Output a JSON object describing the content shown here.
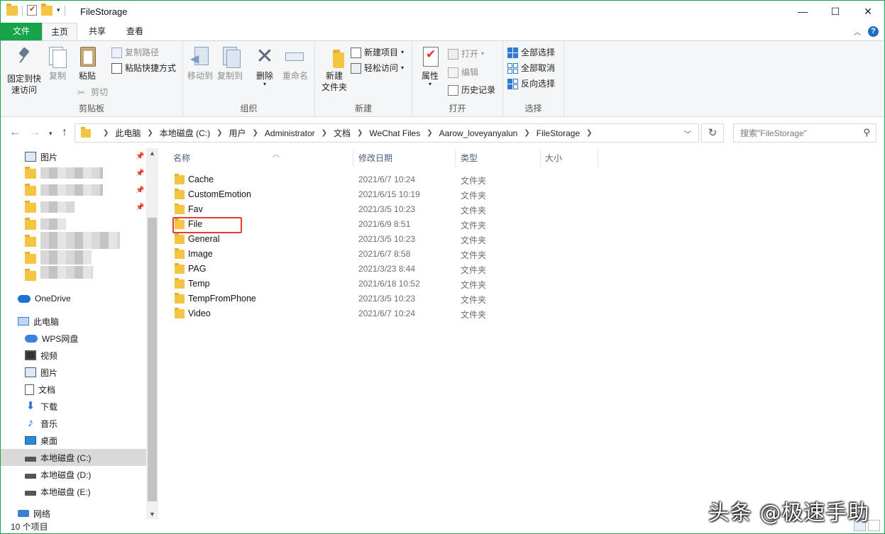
{
  "window": {
    "title": "FileStorage"
  },
  "ribbon_tabs": [
    "文件",
    "主页",
    "共享",
    "查看"
  ],
  "ribbon": {
    "clipboard": {
      "label": "剪贴板",
      "pin": "固定到快速访问",
      "pin_l1": "固定到快",
      "pin_l2": "速访问",
      "copy": "复制",
      "paste": "粘贴",
      "copy_path": "复制路径",
      "paste_shortcut": "粘贴快捷方式",
      "cut": "剪切"
    },
    "organize": {
      "label": "组织",
      "move_to": "移动到",
      "copy_to": "复制到",
      "delete": "删除",
      "rename": "重命名"
    },
    "new": {
      "label": "新建",
      "new_folder_l1": "新建",
      "new_folder_l2": "文件夹",
      "new_item": "新建项目",
      "easy_access": "轻松访问"
    },
    "open": {
      "label": "打开",
      "properties": "属性",
      "open": "打开",
      "edit": "编辑",
      "history": "历史记录"
    },
    "select": {
      "label": "选择",
      "select_all": "全部选择",
      "select_none": "全部取消",
      "invert": "反向选择"
    }
  },
  "address": {
    "crumbs": [
      "此电脑",
      "本地磁盘 (C:)",
      "用户",
      "Administrator",
      "文档",
      "WeChat Files",
      "Aarow_loveyanyalun",
      "FileStorage"
    ],
    "search_placeholder": "搜索\"FileStorage\""
  },
  "nav": {
    "pictures_quick": "图片",
    "onedrive": "OneDrive",
    "this_pc": "此电脑",
    "wps": "WPS网盘",
    "videos": "视频",
    "pictures": "图片",
    "documents": "文档",
    "downloads": "下载",
    "music": "音乐",
    "desktop": "桌面",
    "drive_c": "本地磁盘 (C:)",
    "drive_d": "本地磁盘 (D:)",
    "drive_e": "本地磁盘 (E:)",
    "network": "网络"
  },
  "columns": {
    "name": "名称",
    "modified": "修改日期",
    "type": "类型",
    "size": "大小"
  },
  "files": [
    {
      "name": "Cache",
      "modified": "2021/6/7 10:24",
      "type": "文件夹"
    },
    {
      "name": "CustomEmotion",
      "modified": "2021/6/15 10:19",
      "type": "文件夹"
    },
    {
      "name": "Fav",
      "modified": "2021/3/5 10:23",
      "type": "文件夹"
    },
    {
      "name": "File",
      "modified": "2021/6/9 8:51",
      "type": "文件夹"
    },
    {
      "name": "General",
      "modified": "2021/3/5 10:23",
      "type": "文件夹"
    },
    {
      "name": "Image",
      "modified": "2021/6/7 8:58",
      "type": "文件夹"
    },
    {
      "name": "PAG",
      "modified": "2021/3/23 8:44",
      "type": "文件夹"
    },
    {
      "name": "Temp",
      "modified": "2021/6/18 10:52",
      "type": "文件夹"
    },
    {
      "name": "TempFromPhone",
      "modified": "2021/3/5 10:23",
      "type": "文件夹"
    },
    {
      "name": "Video",
      "modified": "2021/6/7 10:24",
      "type": "文件夹"
    }
  ],
  "status": {
    "count": "10 个项目"
  },
  "watermark": "头条 @极速手助",
  "colors": {
    "accent": "#17a34a",
    "highlight_box": "#e53c3c"
  }
}
